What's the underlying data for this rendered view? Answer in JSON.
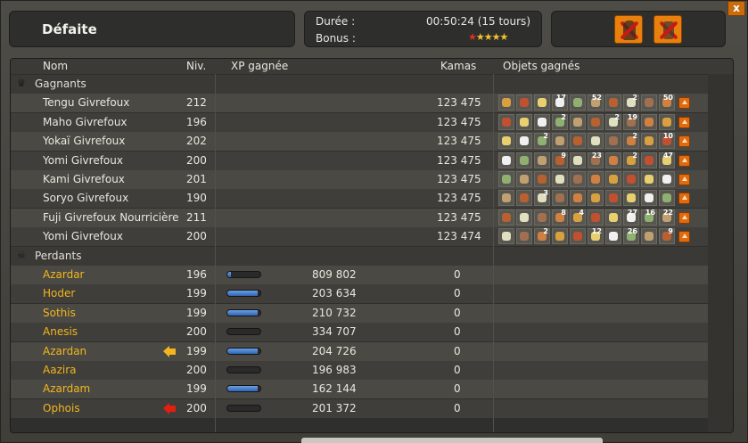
{
  "window": {
    "close_label": "x"
  },
  "title": "Défaite",
  "info": {
    "duration_label": "Durée :",
    "duration_value": "00:50:24 (15 tours)",
    "bonus_label": "Bonus :",
    "stars_total": 5,
    "stars_red": 1
  },
  "columns": {
    "name": "Nom",
    "level": "Niv.",
    "xp": "XP gagnée",
    "kamas": "Kamas",
    "items": "Objets gagnés"
  },
  "groups": {
    "winners": "Gagnants",
    "losers": "Perdants"
  },
  "winners": [
    {
      "name": "Tengu Givrefoux",
      "level": "212",
      "kamas": "123 475",
      "item_qty": [
        "",
        "",
        "",
        "17",
        "",
        "52",
        "",
        "2",
        "",
        "50"
      ]
    },
    {
      "name": "Maho Givrefoux",
      "level": "196",
      "kamas": "123 475",
      "item_qty": [
        "",
        "",
        "",
        "2",
        "",
        "",
        "2",
        "19",
        "",
        ""
      ]
    },
    {
      "name": "Yokaï Givrefoux",
      "level": "202",
      "kamas": "123 475",
      "item_qty": [
        "",
        "",
        "2",
        "",
        "",
        "",
        "",
        "2",
        "",
        "10"
      ]
    },
    {
      "name": "Yomi Givrefoux",
      "level": "200",
      "kamas": "123 475",
      "item_qty": [
        "",
        "",
        "",
        "9",
        "",
        "23",
        "",
        "2",
        "",
        "47"
      ]
    },
    {
      "name": "Kami Givrefoux",
      "level": "201",
      "kamas": "123 475",
      "item_qty": [
        "",
        "",
        "",
        "",
        "",
        "",
        "",
        "",
        "",
        ""
      ]
    },
    {
      "name": "Soryo Givrefoux",
      "level": "190",
      "kamas": "123 475",
      "item_qty": [
        "",
        "",
        "3",
        "",
        "",
        "",
        "",
        "",
        "",
        ""
      ]
    },
    {
      "name": "Fuji Givrefoux Nourricière",
      "level": "211",
      "kamas": "123 475",
      "item_qty": [
        "",
        "",
        "",
        "8",
        "4",
        "",
        "",
        "27",
        "16",
        "22"
      ]
    },
    {
      "name": "Yomi Givrefoux",
      "level": "200",
      "kamas": "123 474",
      "item_qty": [
        "",
        "",
        "2",
        "",
        "",
        "12",
        "",
        "26",
        "",
        "9"
      ]
    }
  ],
  "winners_extra_qty": [
    "",
    "",
    "",
    "",
    "",
    "",
    "",
    "7",
    "29",
    "13"
  ],
  "losers": [
    {
      "name": "Azardar",
      "level": "196",
      "xp": "809 802",
      "kamas": "0",
      "xp_fraction": 0.1,
      "marker": ""
    },
    {
      "name": "Hoder",
      "level": "199",
      "xp": "203 634",
      "kamas": "0",
      "xp_fraction": 0.92,
      "marker": ""
    },
    {
      "name": "Sothis",
      "level": "199",
      "xp": "210 732",
      "kamas": "0",
      "xp_fraction": 0.92,
      "marker": ""
    },
    {
      "name": "Anesis",
      "level": "200",
      "xp": "334 707",
      "kamas": "0",
      "xp_fraction": 0.0,
      "marker": ""
    },
    {
      "name": "Azardan",
      "level": "199",
      "xp": "204 726",
      "kamas": "0",
      "xp_fraction": 0.92,
      "marker": "yellow"
    },
    {
      "name": "Aazira",
      "level": "200",
      "xp": "196 983",
      "kamas": "0",
      "xp_fraction": 0.0,
      "marker": ""
    },
    {
      "name": "Azardam",
      "level": "199",
      "xp": "162 144",
      "kamas": "0",
      "xp_fraction": 0.92,
      "marker": ""
    },
    {
      "name": "Ophois",
      "level": "200",
      "xp": "201 372",
      "kamas": "0",
      "xp_fraction": 0.0,
      "marker": "red"
    }
  ],
  "colors": {
    "loser_name": "#f3b61d",
    "xp_fill": "#2f64b4",
    "button_orange": "#e7800c"
  }
}
